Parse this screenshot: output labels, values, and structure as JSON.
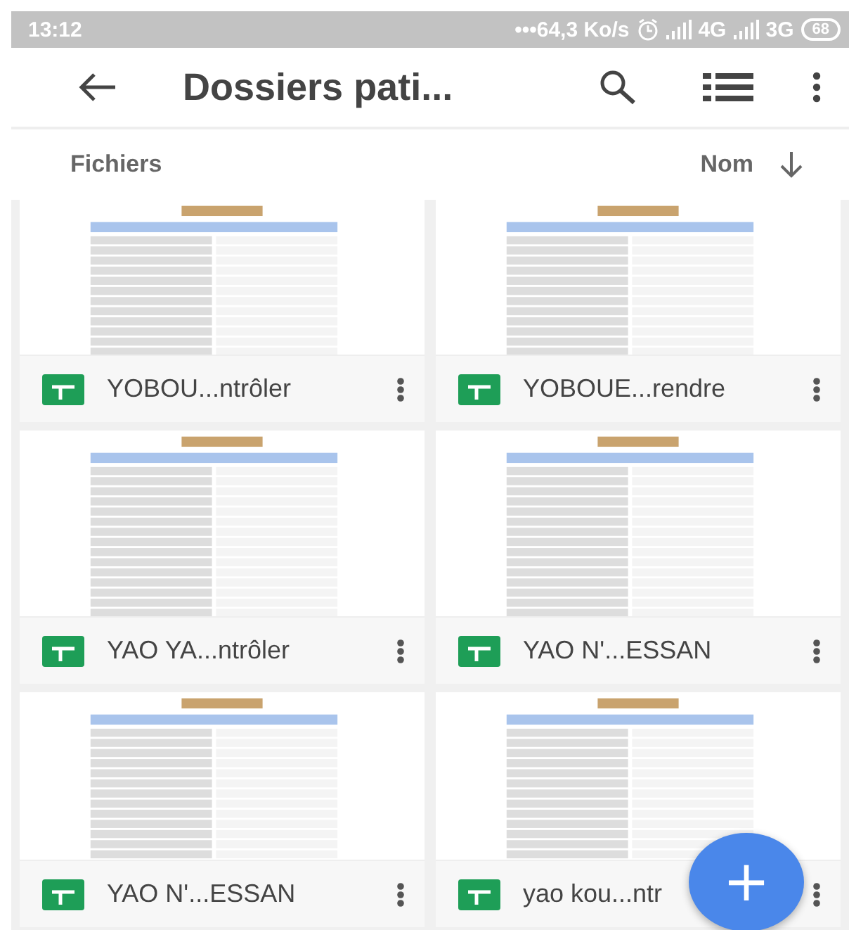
{
  "status_bar": {
    "time": "13:12",
    "speed": "•••64,3 Ko/s",
    "network_1": "4G",
    "network_2": "3G",
    "battery": "68"
  },
  "toolbar": {
    "title": "Dossiers pati..."
  },
  "list_header": {
    "section": "Fichiers",
    "sort": "Nom"
  },
  "files": [
    {
      "name": "YOBOU...ntrôler"
    },
    {
      "name": "YOBOUE...rendre"
    },
    {
      "name": "YAO YA...ntrôler"
    },
    {
      "name": "YAO N'...ESSAN"
    },
    {
      "name": "YAO N'...ESSAN"
    },
    {
      "name": "yao kou...ntr"
    }
  ],
  "fab": {
    "label": "+"
  }
}
